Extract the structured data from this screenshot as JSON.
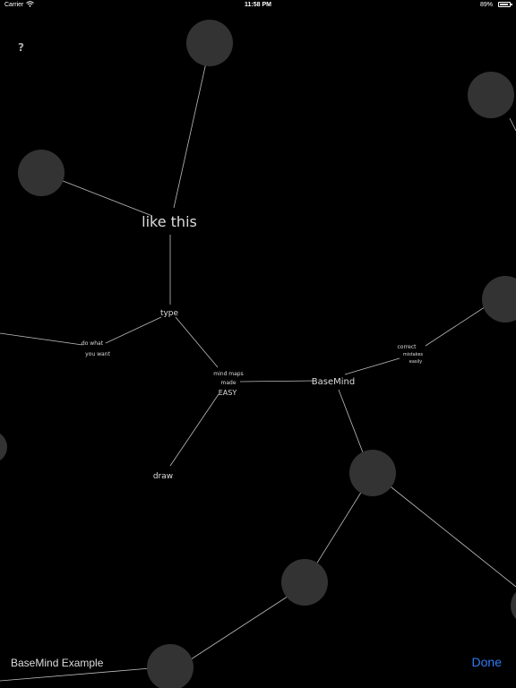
{
  "status_bar": {
    "carrier": "Carrier",
    "time": "11:58 PM",
    "battery_percent": "89%",
    "battery_level": 0.89
  },
  "toolbar": {
    "help_icon": "?"
  },
  "mind_map": {
    "labels": {
      "like_this": "like this",
      "type": "type",
      "do_what_line1": "do what",
      "do_what_line2": "you want",
      "mind_maps_line1": "mind maps",
      "mind_maps_line2": "made",
      "mind_maps_line3": "EASY",
      "basemind": "BaseMind",
      "correct_line1": "correct",
      "correct_line2": "mistakes",
      "correct_line3": "easily",
      "draw": "draw"
    },
    "colors": {
      "background": "#000000",
      "edge": "#bdbdbd",
      "bubble": "#333333"
    }
  },
  "bottom_bar": {
    "title": "BaseMind Example",
    "done_label": "Done",
    "done_color": "#2f7bf5"
  }
}
